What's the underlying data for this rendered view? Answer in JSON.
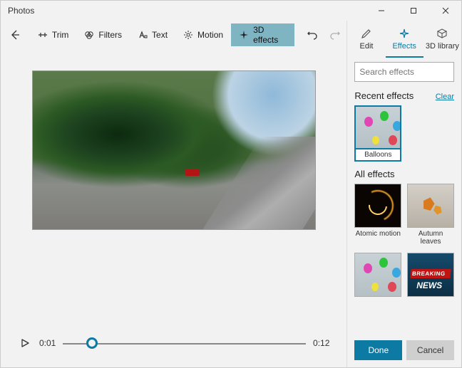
{
  "title": "Photos",
  "toolbar": {
    "trim": "Trim",
    "filters": "Filters",
    "text": "Text",
    "motion": "Motion",
    "3d_effects": "3D effects"
  },
  "player": {
    "current_time": "0:01",
    "total_time": "0:12",
    "progress_pct": 12
  },
  "side_tabs": {
    "edit": "Edit",
    "effects": "Effects",
    "library": "3D library"
  },
  "search_placeholder": "Search effects",
  "sections": {
    "recent_label": "Recent effects",
    "clear_label": "Clear",
    "all_label": "All effects"
  },
  "recent_effects": [
    {
      "label": "Balloons",
      "thumb_class": "th-balloons",
      "selected": true
    }
  ],
  "all_effects": [
    {
      "label": "Atomic motion",
      "thumb_class": "th-atomic"
    },
    {
      "label": "Autumn leaves",
      "thumb_class": "th-leaves"
    },
    {
      "label": "",
      "thumb_class": "th-balloons"
    },
    {
      "label": "",
      "thumb_class": "th-breaking"
    }
  ],
  "footer": {
    "done": "Done",
    "cancel": "Cancel"
  }
}
